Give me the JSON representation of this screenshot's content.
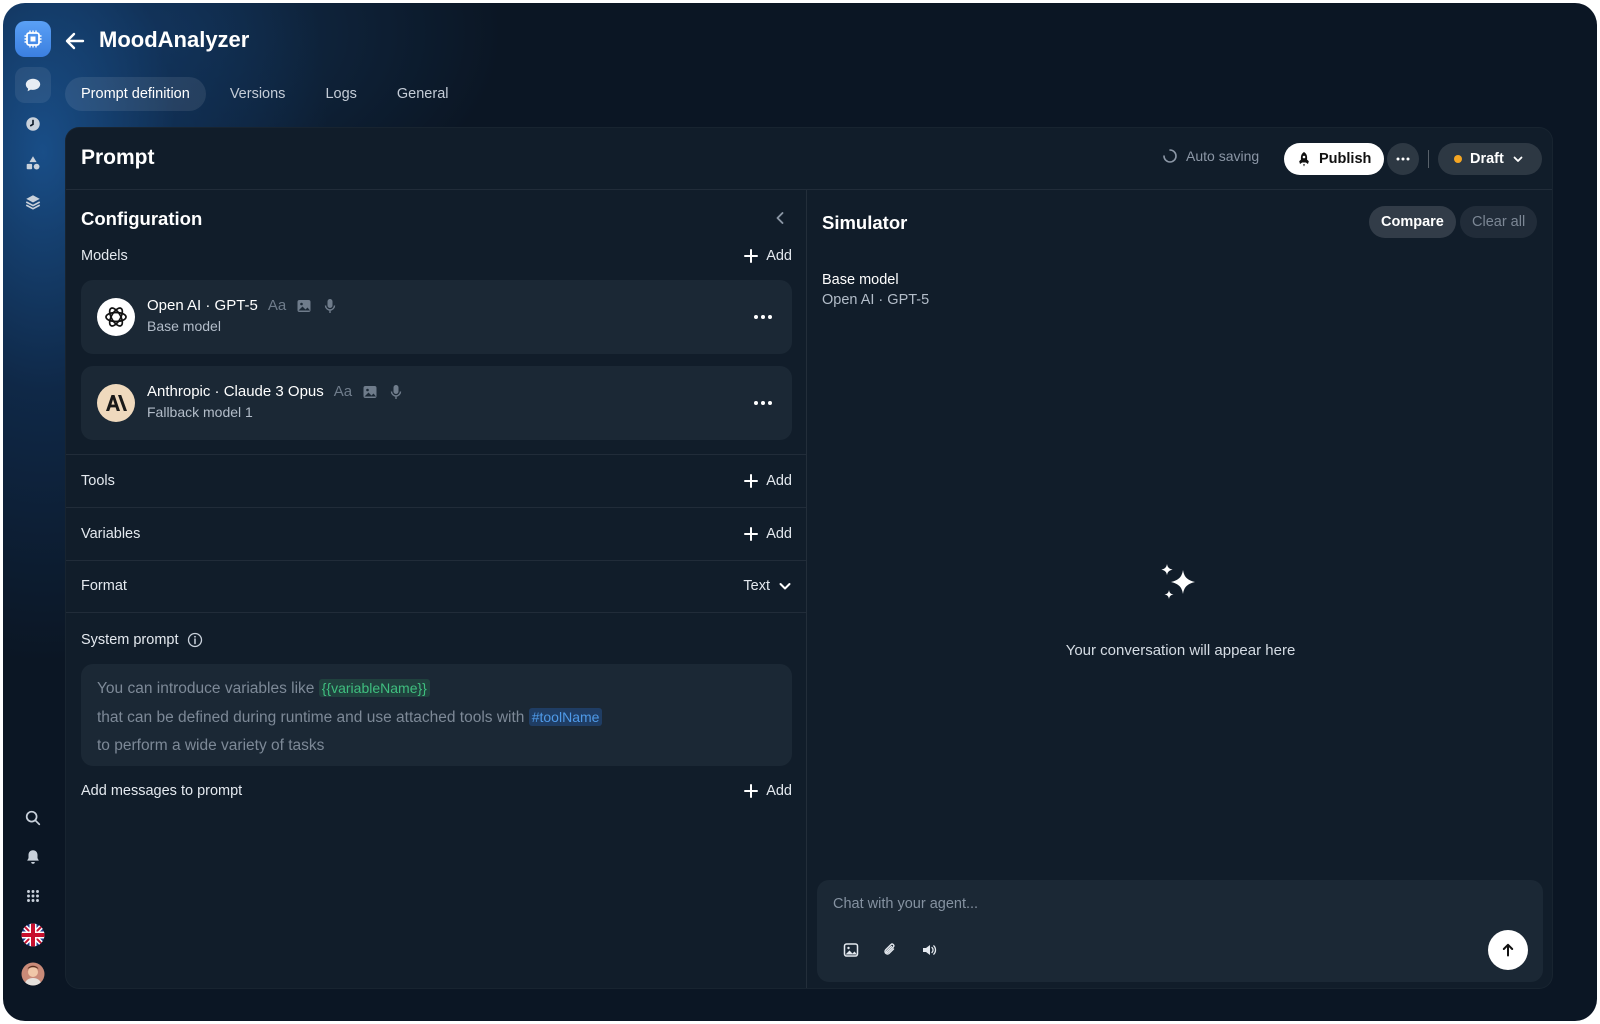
{
  "app": {
    "title": "MoodAnalyzer"
  },
  "tabs": [
    {
      "label": "Prompt definition",
      "active": true
    },
    {
      "label": "Versions",
      "active": false
    },
    {
      "label": "Logs",
      "active": false
    },
    {
      "label": "General",
      "active": false
    }
  ],
  "rail": {
    "top_icons": [
      "chat-icon",
      "clock-icon",
      "shapes-icon",
      "layers-icon"
    ],
    "bottom_icons": [
      "search-icon",
      "bell-icon",
      "apps-grid-icon",
      "uk-flag-icon",
      "user-avatar"
    ]
  },
  "panel": {
    "title": "Prompt",
    "autosave_label": "Auto saving",
    "publish_label": "Publish",
    "status_label": "Draft",
    "status_color": "#f5a623"
  },
  "config": {
    "title": "Configuration",
    "models_label": "Models",
    "add_label": "Add",
    "models": [
      {
        "name": "Open AI · GPT-5",
        "role": "Base model",
        "caps_text": "Aa"
      },
      {
        "name": "Anthropic · Claude 3 Opus",
        "role": "Fallback model 1",
        "caps_text": "Aa"
      }
    ],
    "tools_label": "Tools",
    "variables_label": "Variables",
    "format_label": "Format",
    "format_value": "Text",
    "system_prompt_label": "System prompt",
    "system_prompt": {
      "line1_text": "You can introduce variables like",
      "line1_chip": "{{variableName}}",
      "line2_text": "that can be defined during runtime and use  attached tools with",
      "line2_chip": "#toolName",
      "line3_text": "to perform a wide variety of tasks"
    },
    "messages_label": "Add messages to prompt"
  },
  "simulator": {
    "title": "Simulator",
    "compare_label": "Compare",
    "clear_label": "Clear all",
    "base_model_label": "Base model",
    "base_model_value": "Open AI · GPT-5",
    "empty_text": "Your conversation will appear here",
    "chat_placeholder": "Chat with your agent..."
  },
  "colors": {
    "accent": "#3b7fe0",
    "background": "#0b1624",
    "panel": "#111d2a",
    "card": "#1b2835",
    "variable_chip": "#3fbf7f",
    "tool_chip": "#4f9ae8"
  }
}
